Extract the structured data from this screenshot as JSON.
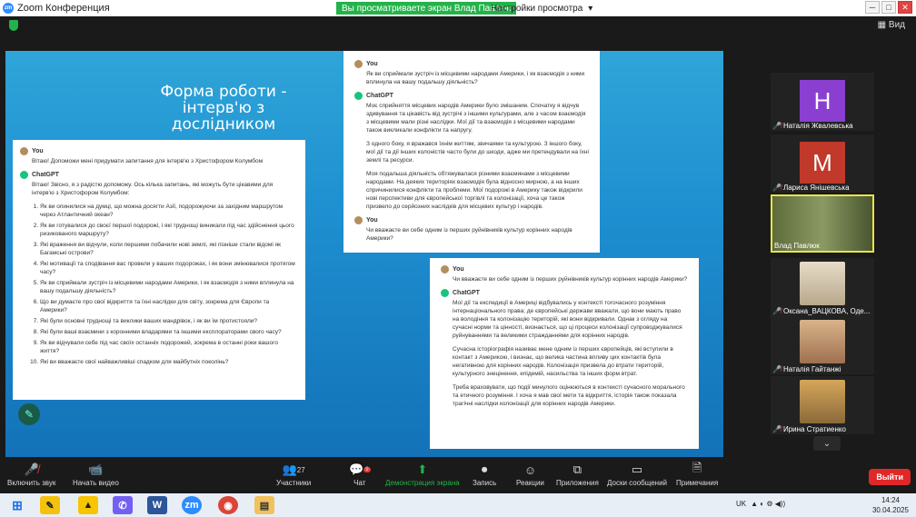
{
  "window": {
    "title": "Zoom Конференция",
    "share_banner": "Вы просматриваете экран Влад Павлюк",
    "view_options": "Настройки просмотра",
    "view_label": "Вид"
  },
  "slide": {
    "title": "Форма роботи - інтерв'ю з дослідником"
  },
  "card_left": {
    "you_label": "You",
    "you_text": "Вітаю! Допоможи мені придумати запитання для інтерв'ю з Христофором Колумбом",
    "gpt_label": "ChatGPT",
    "gpt_intro": "Вітаю! Звісно, я з радістю допоможу. Ось кілька запитань, які можуть бути цікавими для інтерв'ю з Христофором Колумбом:",
    "questions": [
      "Як ви опинилися на думці, що можна досягти Азії, подорожуючи за західним маршрутом через Атлантичний океан?",
      "Як ви готувалися до своєї першої подорожі, і які труднощі виникали під час здійснення цього ризикованого маршруту?",
      "Які враження ви відчули, коли першими побачили нові землі, які пізніше стали відомі як Багамські острови?",
      "Які мотивації та сподівання вас провели у ваших подорожах, і як вони змінювалися протягом часу?",
      "Як ви сприймали зустріч із місцевими народами Америки, і як взаємодія з ними вплинула на вашу подальшу діяльність?",
      "Що ви думаєте про свої відкриття та їхні наслідки для світу, зокрема для Європи та Америки?",
      "Які були основні труднощі та виклики ваших мандрівок, і як ви їм протистояли?",
      "Які були ваші взаємини з коронними владарями та іншими експлораторами свого часу?",
      "Як ви відчували себе під час своїх останніх подорожей, зокрема в останні роки вашого життя?",
      "Які ви вважаєте свої найважливіші спадком для майбутніх поколінь?"
    ]
  },
  "card_top": {
    "you_label": "You",
    "you_text": "Як ви сприймали зустріч із місцевими народами Америки, і як взаємодія з ними вплинула на вашу подальшу діяльність?",
    "gpt_label": "ChatGPT",
    "p1": "Моє сприйняття місцевих народів Америки було змішаним. Спочатку я відчув здивування та цікавість від зустрічі з іншими культурами, але з часом взаємодія з місцевими мали різні наслідки. Мої дії та взаємодія з місцевими народами також викликали конфлікти та напругу.",
    "p2": "З одного боку, я вражався їхнім життям, звичаями та культурою. З іншого боку, мої дії та дії інших колоністів часто були до шкоди, адже ми претендували на їхні землі та ресурси.",
    "p3": "Моя подальша діяльність обтяжувалася різними взаєминами з місцевими народами. На деяких територіях взаємодія була відносно мирною, а на інших спричинилися конфлікти та проблеми. Мої подорожі в Америку також відкрили нові перспективи для європейської торгівлі та колонізації, хоча це також призвело до серйозних наслідків для місцевих культур і народів.",
    "you2_label": "You",
    "you2_text": "Чи вважаєте ви себе одним із перших руйнівників культур корінних народів Америки?"
  },
  "card_bottom": {
    "you_label": "You",
    "you_text": "Чи вважаєте ви себе одним із перших руйнівників культур корінних народів Америки?",
    "gpt_label": "ChatGPT",
    "p1": "Мої дії та експедиції в Америці відбувались у контексті тогочасного розуміння інтернаціонального права; де європейські держави вважали, що вони мають право на володіння та колонізацію територій, які вони відкривали. Однак з огляду на сучасні норми та цінності, визнається, що ці процеси колонізації супроводжувалися руйнуваннями та великими стражданнями для корінних народів.",
    "p2": "Сучасна історіографія називає мене одним із перших європейців, які вступили в контакт з Америкою, і визнає, що велика частина впливу цих контактів була негативною для корінних народів. Колонізація призвела до втрати територій, культурного знецінення, епідемій, насильства та інших форм втрат.",
    "p3": "Треба враховувати, що події минулого оцінюються в контексті сучасного морального та етичного розуміння. І хоча я мав свої мети та відкриття, історія також показала трагічні наслідки колонізації для корінних народів Америки."
  },
  "participants": [
    {
      "name": "Наталія Жвалевська",
      "initial": "H",
      "color": "#8a3fd1"
    },
    {
      "name": "Лариса Янішевська",
      "initial": "M",
      "color": "#c0392b"
    },
    {
      "name": "Влад Павлюк",
      "initial": "",
      "color": "#6b7a4a"
    },
    {
      "name": "Оксана_ВАЦКОВА, Оде...",
      "initial": "",
      "color": "#b8a88c"
    },
    {
      "name": "Наталія Гайтанжі",
      "initial": "",
      "color": "#c49a6c"
    },
    {
      "name": "Ирина Стратиенко",
      "initial": "",
      "color": "#d6a65a"
    }
  ],
  "toolbar": {
    "mute": "Включить звук",
    "video": "Начать видео",
    "participants": "Участники",
    "participants_count": "27",
    "chat": "Чат",
    "chat_badge": "9",
    "share": "Демонстрация экрана",
    "record": "Запись",
    "reactions": "Реакции",
    "apps": "Приложения",
    "whiteboards": "Доски сообщений",
    "notes": "Примечания",
    "leave": "Выйти"
  },
  "taskbar": {
    "lang": "UK",
    "time": "14:24",
    "date": "30.04.2025"
  }
}
